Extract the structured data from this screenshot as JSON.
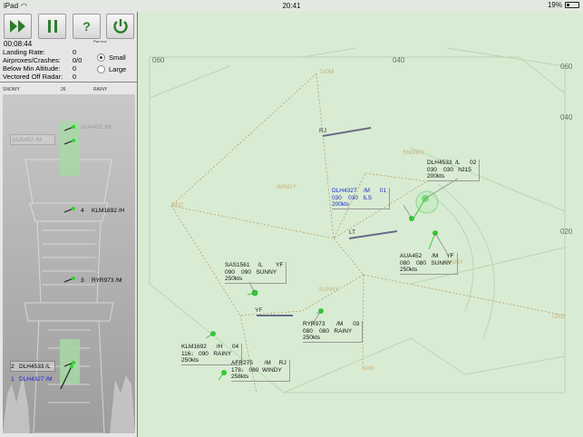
{
  "status_bar": {
    "device": "iPad",
    "time": "20:41",
    "battery": "19%"
  },
  "toolbar": {
    "power_label": "Pwr-box"
  },
  "timer": "00:08:44",
  "stats": [
    {
      "label": "Landing Rate:",
      "value": "0"
    },
    {
      "label": "Airproxes/Crashes:",
      "value": "0/0"
    },
    {
      "label": "Below Min Altitude:",
      "value": "0"
    },
    {
      "label": "Vectored Off Radar:",
      "value": "0"
    }
  ],
  "size_options": {
    "small": "Small",
    "large": "Large",
    "selected": "Small"
  },
  "weather": {
    "left": "SNOWY",
    "center": "26",
    "right": "RAINY"
  },
  "queue": [
    {
      "pos": "",
      "callsign": "AUA452 /M",
      "ghost": true
    },
    {
      "pos": "4",
      "callsign": "KLM1692 /H"
    },
    {
      "pos": "3",
      "callsign": "RYR973 /M"
    },
    {
      "pos": "2",
      "callsign": "DLH4533 /L"
    },
    {
      "pos": "1",
      "callsign": "DLH4327 /M",
      "active": true
    }
  ],
  "radar": {
    "headings": [
      "060",
      "040",
      "060",
      "040",
      "020"
    ],
    "waypoints": [
      "DOM",
      "SNOWY",
      "WINDY",
      "SUNNY",
      "RAINY",
      "NAN",
      "BEC",
      "OXD"
    ],
    "runways": [
      "RJ",
      "LT",
      "YF"
    ],
    "aircraft": [
      {
        "callsign": "DLH4533",
        "wtc": "/L",
        "dest": "02",
        "alt": "030",
        "cfl": "030",
        "extra": "h215",
        "speed": "200kts"
      },
      {
        "callsign": "DLH4327",
        "wtc": "/M",
        "dest": "01",
        "alt": "030",
        "cfl": "030",
        "extra": "ILS",
        "speed": "200kts",
        "selected": true
      },
      {
        "callsign": "AUA452",
        "wtc": "/M",
        "dest": "YF",
        "alt": "080",
        "cfl": "080",
        "extra": "SUNNY",
        "speed": "250kts"
      },
      {
        "callsign": "SAS1561",
        "wtc": "/L",
        "dest": "YF",
        "alt": "090",
        "cfl": "090",
        "extra": "SUNNY",
        "speed": "250kts"
      },
      {
        "callsign": "RYR973",
        "wtc": "/M",
        "dest": "03",
        "alt": "080",
        "cfl": "080",
        "extra": "RAINY",
        "speed": "250kts"
      },
      {
        "callsign": "KLM1692",
        "wtc": "/H",
        "dest": "04",
        "alt": "116↓",
        "cfl": "090",
        "extra": "RAINY",
        "speed": "250kts"
      },
      {
        "callsign": "AFR275",
        "wtc": "/M",
        "dest": "RJ",
        "alt": "178↓",
        "cfl": "080",
        "extra": "WINDY",
        "speed": "258kts"
      }
    ]
  },
  "colors": {
    "radar_bg": "#d8ecd3",
    "blip": "#2bd62b",
    "selected_tag": "#1b2ccf",
    "waypoint": "#c8b07a"
  }
}
